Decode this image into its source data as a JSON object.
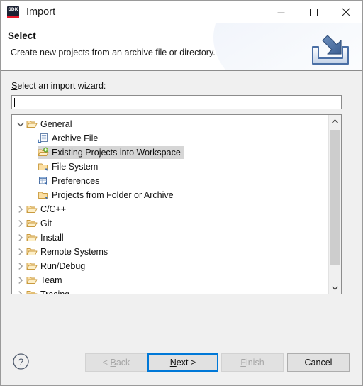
{
  "window": {
    "title": "Import",
    "app_icon_text": "SDK",
    "icon_colors": {
      "bg": "#1c2233",
      "accent": "#e8192c"
    },
    "controls": {
      "minimize": "minimize-icon",
      "maximize": "maximize-icon",
      "close": "close-icon"
    }
  },
  "banner": {
    "title": "Select",
    "description": "Create new projects from an archive file or directory.",
    "icon": "import-arrow-icon",
    "icon_color": "#4a6fa5"
  },
  "form": {
    "label_prefix": "S",
    "label_rest": "elect an import wizard:",
    "filter_value": "",
    "filter_placeholder": ""
  },
  "tree": {
    "rows": [
      {
        "label": "General",
        "indent": 0,
        "twisty": "chevron-down-icon",
        "icon": "folder-open-icon",
        "selected": false
      },
      {
        "label": "Archive File",
        "indent": 1,
        "twisty": "none",
        "icon": "archive-file-icon",
        "selected": false
      },
      {
        "label": "Existing Projects into Workspace",
        "indent": 1,
        "twisty": "none",
        "icon": "folder-import-icon",
        "selected": true
      },
      {
        "label": "File System",
        "indent": 1,
        "twisty": "none",
        "icon": "folder-closed-icon",
        "selected": false
      },
      {
        "label": "Preferences",
        "indent": 1,
        "twisty": "none",
        "icon": "preferences-table-icon",
        "selected": false
      },
      {
        "label": "Projects from Folder or Archive",
        "indent": 1,
        "twisty": "none",
        "icon": "folder-closed-icon",
        "selected": false
      },
      {
        "label": "C/C++",
        "indent": 0,
        "twisty": "chevron-right-icon",
        "icon": "folder-open-icon",
        "selected": false
      },
      {
        "label": "Git",
        "indent": 0,
        "twisty": "chevron-right-icon",
        "icon": "folder-open-icon",
        "selected": false
      },
      {
        "label": "Install",
        "indent": 0,
        "twisty": "chevron-right-icon",
        "icon": "folder-open-icon",
        "selected": false
      },
      {
        "label": "Remote Systems",
        "indent": 0,
        "twisty": "chevron-right-icon",
        "icon": "folder-open-icon",
        "selected": false
      },
      {
        "label": "Run/Debug",
        "indent": 0,
        "twisty": "chevron-right-icon",
        "icon": "folder-open-icon",
        "selected": false
      },
      {
        "label": "Team",
        "indent": 0,
        "twisty": "chevron-right-icon",
        "icon": "folder-open-icon",
        "selected": false
      },
      {
        "label": "Tracing",
        "indent": 0,
        "twisty": "chevron-right-icon",
        "icon": "folder-open-icon",
        "selected": false
      }
    ],
    "scrollbar": {
      "up_arrow": "scroll-up-icon",
      "down_arrow": "scroll-down-icon"
    }
  },
  "footer": {
    "help": "help-icon",
    "buttons": {
      "back": {
        "prefix": "< ",
        "mnemonic": "B",
        "suffix": "ack",
        "enabled": false,
        "default": false
      },
      "next": {
        "prefix": "",
        "mnemonic": "N",
        "suffix": "ext >",
        "enabled": true,
        "default": true
      },
      "finish": {
        "prefix": "",
        "mnemonic": "F",
        "suffix": "inish",
        "enabled": false,
        "default": false
      },
      "cancel": {
        "prefix": "",
        "mnemonic": "",
        "suffix": "Cancel",
        "enabled": true,
        "default": false
      }
    }
  }
}
